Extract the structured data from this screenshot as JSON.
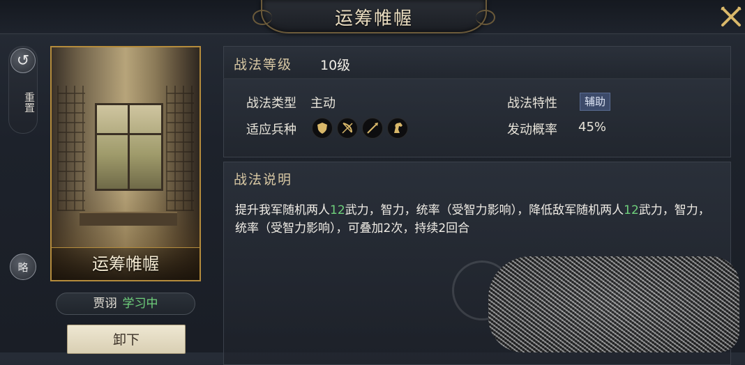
{
  "header": {
    "title": "运筹帷幄"
  },
  "rail": {
    "reset_label": "重置",
    "brief_label": "略"
  },
  "card": {
    "caption": "运筹帷幄"
  },
  "learner": {
    "name": "贾诩",
    "status": "学习中"
  },
  "actions": {
    "unload_label": "卸下"
  },
  "tactic": {
    "level_label": "战法等级",
    "level_value": "10级",
    "type_label": "战法类型",
    "type_value": "主动",
    "trait_label": "战法特性",
    "trait_value": "辅助",
    "troops_label": "适应兵种",
    "troop_icons": [
      "shield-icon",
      "bow-icon",
      "spear-icon",
      "horse-icon"
    ],
    "rate_label": "发动概率",
    "rate_value": "45%"
  },
  "description": {
    "title": "战法说明",
    "part1": "提升我军随机两人",
    "num1": "12",
    "part2": "武力，智力，统率（受智力影响），降低敌军随机两人",
    "num2": "12",
    "part3": "武力，智力，统率（受智力影响），可叠加2次，持续2回合"
  },
  "colors": {
    "highlight": "#6fd17c",
    "frame_gold": "#b58c3c"
  }
}
